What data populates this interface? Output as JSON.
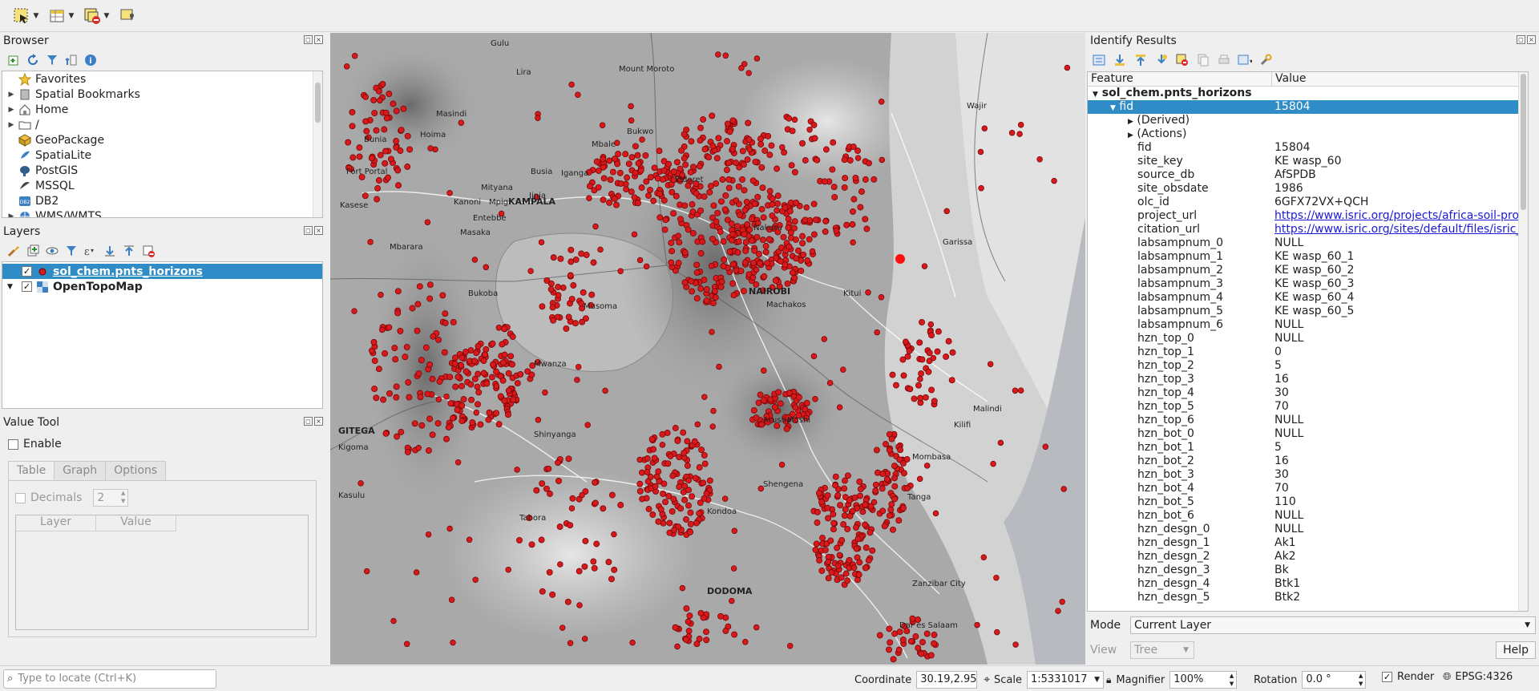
{
  "toolbar": {
    "icons": [
      "select-features-icon",
      "attribute-table-icon",
      "deselect-icon",
      "identify-features-icon"
    ]
  },
  "browser": {
    "title": "Browser",
    "items": [
      {
        "label": "Favorites",
        "icon": "star-icon",
        "expandable": false
      },
      {
        "label": "Spatial Bookmarks",
        "icon": "bookmark-icon",
        "expandable": true
      },
      {
        "label": "Home",
        "icon": "home-icon",
        "expandable": true
      },
      {
        "label": "/",
        "icon": "folder-icon",
        "expandable": true
      },
      {
        "label": "GeoPackage",
        "icon": "geopackage-icon",
        "expandable": false
      },
      {
        "label": "SpatiaLite",
        "icon": "spatialite-icon",
        "expandable": false
      },
      {
        "label": "PostGIS",
        "icon": "postgis-icon",
        "expandable": false
      },
      {
        "label": "MSSQL",
        "icon": "mssql-icon",
        "expandable": false
      },
      {
        "label": "DB2",
        "icon": "db2-icon",
        "expandable": false
      },
      {
        "label": "WMS/WMTS",
        "icon": "wms-icon",
        "expandable": true
      }
    ]
  },
  "layers": {
    "title": "Layers",
    "items": [
      {
        "label": "sol_chem.pnts_horizons",
        "checked": true,
        "selected": true
      },
      {
        "label": "OpenTopoMap",
        "checked": true,
        "selected": false
      }
    ]
  },
  "value_tool": {
    "title": "Value Tool",
    "enable_label": "Enable",
    "tabs": [
      "Table",
      "Graph",
      "Options"
    ],
    "decimals_label": "Decimals",
    "decimals_value": "2",
    "columns": [
      "Layer",
      "Value"
    ]
  },
  "map": {
    "labels": [
      {
        "text": "Gulu",
        "bold": false
      },
      {
        "text": "Lira",
        "bold": false
      },
      {
        "text": "Mount Moroto",
        "bold": false
      },
      {
        "text": "Masindi",
        "bold": false
      },
      {
        "text": "Hoima",
        "bold": false
      },
      {
        "text": "Bunia",
        "bold": false
      },
      {
        "text": "Fort Portal",
        "bold": false
      },
      {
        "text": "Kasese",
        "bold": false
      },
      {
        "text": "Mityana",
        "bold": false
      },
      {
        "text": "Kanoni",
        "bold": false
      },
      {
        "text": "Mpigi",
        "bold": false
      },
      {
        "text": "Jinja",
        "bold": false
      },
      {
        "text": "KAMPALA",
        "bold": true
      },
      {
        "text": "Entebbe",
        "bold": false
      },
      {
        "text": "Masaka",
        "bold": false
      },
      {
        "text": "Mbarara",
        "bold": false
      },
      {
        "text": "Mbale",
        "bold": false
      },
      {
        "text": "Bukwo",
        "bold": false
      },
      {
        "text": "Eldoret",
        "bold": false
      },
      {
        "text": "Iganga",
        "bold": false
      },
      {
        "text": "Busia",
        "bold": false
      },
      {
        "text": "Nakuru",
        "bold": false
      },
      {
        "text": "NAIROBI",
        "bold": true
      },
      {
        "text": "Machakos",
        "bold": false
      },
      {
        "text": "Kitui",
        "bold": false
      },
      {
        "text": "Garissa",
        "bold": false
      },
      {
        "text": "Wajir",
        "bold": false
      },
      {
        "text": "Bukoba",
        "bold": false
      },
      {
        "text": "Musoma",
        "bold": false
      },
      {
        "text": "Mwanza",
        "bold": false
      },
      {
        "text": "Shinyanga",
        "bold": false
      },
      {
        "text": "Tabora",
        "bold": false
      },
      {
        "text": "Arusha",
        "bold": false
      },
      {
        "text": "Moshi",
        "bold": false
      },
      {
        "text": "Kondoa",
        "bold": false
      },
      {
        "text": "Shengena",
        "bold": false
      },
      {
        "text": "Tanga",
        "bold": false
      },
      {
        "text": "Mombasa",
        "bold": false
      },
      {
        "text": "Malindi",
        "bold": false
      },
      {
        "text": "Kilifi",
        "bold": false
      },
      {
        "text": "Zanzibar City",
        "bold": false
      },
      {
        "text": "DODOMA",
        "bold": true
      },
      {
        "text": "Dar es Salaam",
        "bold": false
      },
      {
        "text": "GITEGA",
        "bold": true
      },
      {
        "text": "Kigoma",
        "bold": false
      },
      {
        "text": "Kasulu",
        "bold": false
      }
    ]
  },
  "identify": {
    "title": "Identify Results",
    "col_feature": "Feature",
    "col_value": "Value",
    "layer_name": "sol_chem.pnts_horizons",
    "feature_label": "fid",
    "feature_value": "15804",
    "groups": [
      "(Derived)",
      "(Actions)"
    ],
    "rows": [
      {
        "f": "fid",
        "v": "15804",
        "link": false
      },
      {
        "f": "site_key",
        "v": "KE wasp_60",
        "link": false
      },
      {
        "f": "source_db",
        "v": "AfSPDB",
        "link": false
      },
      {
        "f": "site_obsdate",
        "v": "1986",
        "link": false
      },
      {
        "f": "olc_id",
        "v": "6GFX72VX+QCH",
        "link": false
      },
      {
        "f": "project_url",
        "v": "https://www.isric.org/projects/africa-soil-profiles",
        "link": true
      },
      {
        "f": "citation_url",
        "v": "https://www.isric.org/sites/default/files/isric_r",
        "link": true
      },
      {
        "f": "labsampnum_0",
        "v": "NULL",
        "link": false
      },
      {
        "f": "labsampnum_1",
        "v": "KE wasp_60_1",
        "link": false
      },
      {
        "f": "labsampnum_2",
        "v": "KE wasp_60_2",
        "link": false
      },
      {
        "f": "labsampnum_3",
        "v": "KE wasp_60_3",
        "link": false
      },
      {
        "f": "labsampnum_4",
        "v": "KE wasp_60_4",
        "link": false
      },
      {
        "f": "labsampnum_5",
        "v": "KE wasp_60_5",
        "link": false
      },
      {
        "f": "labsampnum_6",
        "v": "NULL",
        "link": false
      },
      {
        "f": "hzn_top_0",
        "v": "NULL",
        "link": false
      },
      {
        "f": "hzn_top_1",
        "v": "0",
        "link": false
      },
      {
        "f": "hzn_top_2",
        "v": "5",
        "link": false
      },
      {
        "f": "hzn_top_3",
        "v": "16",
        "link": false
      },
      {
        "f": "hzn_top_4",
        "v": "30",
        "link": false
      },
      {
        "f": "hzn_top_5",
        "v": "70",
        "link": false
      },
      {
        "f": "hzn_top_6",
        "v": "NULL",
        "link": false
      },
      {
        "f": "hzn_bot_0",
        "v": "NULL",
        "link": false
      },
      {
        "f": "hzn_bot_1",
        "v": "5",
        "link": false
      },
      {
        "f": "hzn_bot_2",
        "v": "16",
        "link": false
      },
      {
        "f": "hzn_bot_3",
        "v": "30",
        "link": false
      },
      {
        "f": "hzn_bot_4",
        "v": "70",
        "link": false
      },
      {
        "f": "hzn_bot_5",
        "v": "110",
        "link": false
      },
      {
        "f": "hzn_bot_6",
        "v": "NULL",
        "link": false
      },
      {
        "f": "hzn_desgn_0",
        "v": "NULL",
        "link": false
      },
      {
        "f": "hzn_desgn_1",
        "v": "Ak1",
        "link": false
      },
      {
        "f": "hzn_desgn_2",
        "v": "Ak2",
        "link": false
      },
      {
        "f": "hzn_desgn_3",
        "v": "Bk",
        "link": false
      },
      {
        "f": "hzn_desgn_4",
        "v": "Btk1",
        "link": false
      },
      {
        "f": "hzn_desgn_5",
        "v": "Btk2",
        "link": false
      }
    ],
    "mode_label": "Mode",
    "mode_value": "Current Layer",
    "view_label": "View",
    "view_value": "Tree",
    "help_label": "Help"
  },
  "statusbar": {
    "locate_placeholder": "Type to locate (Ctrl+K)",
    "coordinate_label": "Coordinate",
    "coordinate_value": "30.19,2.95",
    "scale_label": "Scale",
    "scale_value": "1:5331017",
    "magnifier_label": "Magnifier",
    "magnifier_value": "100%",
    "rotation_label": "Rotation",
    "rotation_value": "0.0 °",
    "render_label": "Render",
    "crs_label": "EPSG:4326"
  },
  "colors": {
    "accent": "#308cc6",
    "point_fill": "#d7191c",
    "point_stroke": "#6b0000"
  }
}
